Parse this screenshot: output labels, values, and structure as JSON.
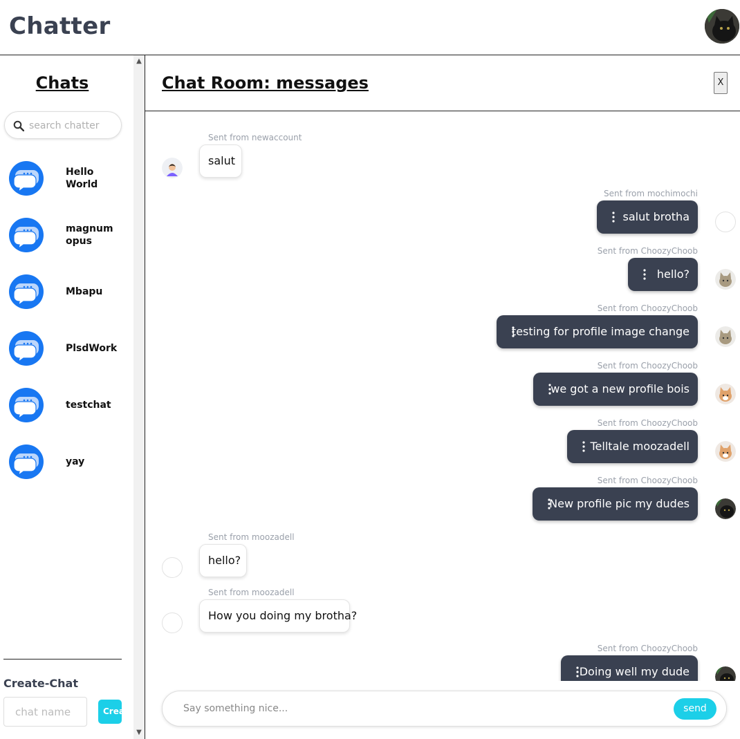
{
  "app": {
    "title": "Chatter",
    "accent_color": "#1ccfe8",
    "chat_icon_color": "#1877f2",
    "sent_bubble_color": "#3a4151"
  },
  "sidebar": {
    "title": "Chats",
    "search_placeholder": "search chatter",
    "chats": [
      {
        "name": "Hello World",
        "icon": "chat-bubbles-icon"
      },
      {
        "name": "magnum opus",
        "icon": "chat-bubbles-icon"
      },
      {
        "name": "Mbapu",
        "icon": "chat-bubbles-icon"
      },
      {
        "name": "PlsdWork",
        "icon": "chat-bubbles-icon"
      },
      {
        "name": "testchat",
        "icon": "chat-bubbles-icon"
      },
      {
        "name": "yay",
        "icon": "chat-bubbles-icon"
      }
    ],
    "create_label": "Create-Chat",
    "create_placeholder": "chat name",
    "create_button": "Create"
  },
  "room": {
    "title": "Chat Room: messages",
    "close_label": "X"
  },
  "messages": [
    {
      "sender": "Sent from newaccount",
      "text": "salut",
      "direction": "in",
      "avatar": "person-avatar"
    },
    {
      "sender": "Sent from mochimochi",
      "text": "salut brotha",
      "direction": "out",
      "avatar": "empty-avatar"
    },
    {
      "sender": "Sent from ChoozyChoob",
      "text": "hello?",
      "direction": "out",
      "avatar": "cat-avatar"
    },
    {
      "sender": "Sent from ChoozyChoob",
      "text": "testing for profile image change",
      "direction": "out",
      "avatar": "cat-avatar"
    },
    {
      "sender": "Sent from ChoozyChoob",
      "text": "we got a new profile bois",
      "direction": "out",
      "avatar": "orange-cat-avatar"
    },
    {
      "sender": "Sent from ChoozyChoob",
      "text": "Telltale moozadell",
      "direction": "out",
      "avatar": "orange-cat-avatar"
    },
    {
      "sender": "Sent from ChoozyChoob",
      "text": "New profile pic my dudes",
      "direction": "out",
      "avatar": "black-cat-avatar"
    },
    {
      "sender": "Sent from moozadell",
      "text": "hello?",
      "direction": "in",
      "avatar": "empty-avatar"
    },
    {
      "sender": "Sent from moozadell",
      "text": "How you doing my brotha?",
      "direction": "in",
      "avatar": "empty-avatar"
    },
    {
      "sender": "Sent from ChoozyChoob",
      "text": "Doing well my dude",
      "direction": "out",
      "avatar": "black-cat-avatar"
    }
  ],
  "composer": {
    "placeholder": "Say something nice...",
    "send_label": "send"
  }
}
